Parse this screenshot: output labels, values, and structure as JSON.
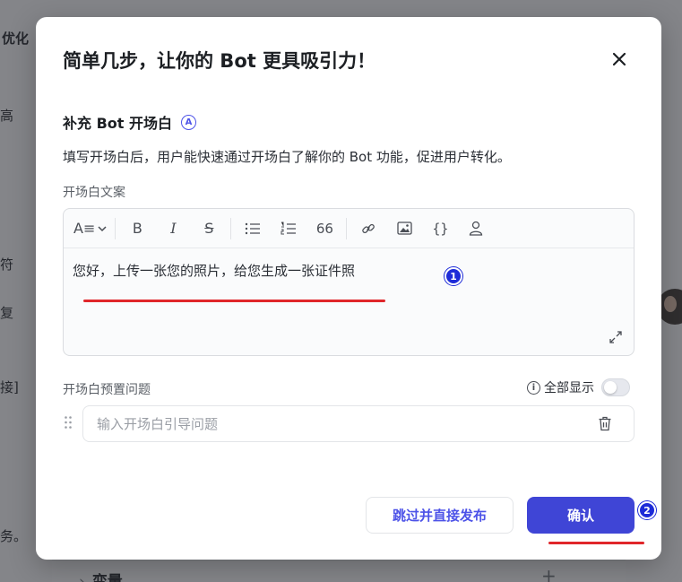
{
  "background": {
    "texts": [
      "优化",
      "高",
      "符",
      "复",
      "接]",
      "务。"
    ],
    "section_label": "变量"
  },
  "modal": {
    "title": "简单几步，让你的 Bot 更具吸引力！",
    "section_title": "补充 Bot 开场白",
    "description": "填写开场白后，用户能快速通过开场白了解你的 Bot 功能，促进用户转化。",
    "opening_text_label": "开场白文案",
    "editor_content": "您好，上传一张您的照片，给您生成一张证件照",
    "preset_questions_label": "开场白预置问题",
    "show_all_label": "全部显示",
    "show_all_enabled": false,
    "question_placeholder": "输入开场白引导问题",
    "skip_button": "跳过并直接发布",
    "confirm_button": "确认"
  },
  "annotations": {
    "badge_1": "1",
    "badge_2": "2",
    "color": "#e0262a"
  },
  "colors": {
    "accent": "#4d53e8",
    "confirm_bg": "#3f45d6",
    "badge_bg": "#1d2bd8"
  }
}
